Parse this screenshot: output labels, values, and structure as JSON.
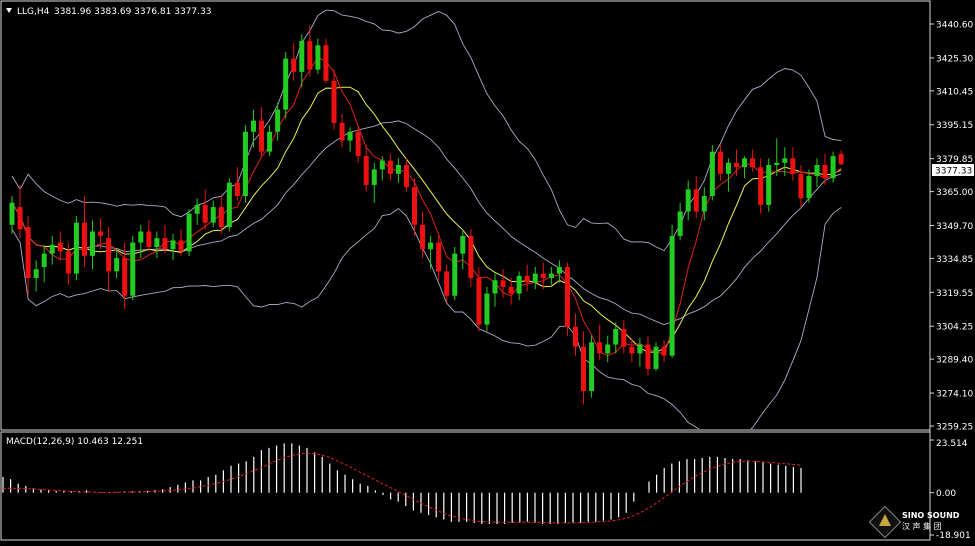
{
  "header": {
    "symbol_label": "LLG,H4",
    "ohlc_label": "3381.96 3383.69 3376.81 3377.33",
    "menu_icon": "triangle-down-icon"
  },
  "indicator": {
    "label": "MACD(12,26,9) 10.463 12.251"
  },
  "price_tag": "3377.33",
  "watermark": {
    "brand": "SINO SOUND",
    "chinese": "汉 声 集 团"
  },
  "colors": {
    "background": "#000000",
    "bull": "#22cc22",
    "bear": "#ee1111",
    "ma_fast": "#dd2222",
    "ma_slow": "#eeee55",
    "bands": "#a8acc8",
    "axis_text": "#ffffff",
    "macd_hist": "#ffffff",
    "macd_signal": "#dd2222"
  },
  "chart_data": [
    {
      "type": "candlestick",
      "title": "LLG,H4",
      "ylim": [
        3259.25,
        3452
      ],
      "y_ticks": [
        "3440.60",
        "3425.30",
        "3410.45",
        "3395.15",
        "3379.85",
        "3365.00",
        "3349.70",
        "3334.85",
        "3319.55",
        "3304.25",
        "3289.40",
        "3274.10",
        "3259.25"
      ],
      "series": [
        {
          "name": "price",
          "ohlc": [
            [
              3350,
              3363,
              3346,
              3360
            ],
            [
              3358,
              3368,
              3344,
              3348
            ],
            [
              3349,
              3354,
              3318,
              3326
            ],
            [
              3326,
              3334,
              3320,
              3330
            ],
            [
              3331,
              3341,
              3324,
              3337
            ],
            [
              3337,
              3345,
              3332,
              3341
            ],
            [
              3342,
              3347,
              3334,
              3338
            ],
            [
              3338,
              3342,
              3323,
              3328
            ],
            [
              3328,
              3354,
              3325,
              3351
            ],
            [
              3351,
              3363,
              3331,
              3336
            ],
            [
              3336,
              3352,
              3330,
              3347
            ],
            [
              3347,
              3353,
              3339,
              3345
            ],
            [
              3344,
              3349,
              3320,
              3329
            ],
            [
              3329,
              3339,
              3326,
              3335
            ],
            [
              3335,
              3342,
              3312,
              3318
            ],
            [
              3318,
              3345,
              3316,
              3342
            ],
            [
              3342,
              3350,
              3335,
              3347
            ],
            [
              3347,
              3352,
              3338,
              3340
            ],
            [
              3340,
              3347,
              3335,
              3344
            ],
            [
              3344,
              3350,
              3337,
              3339
            ],
            [
              3339,
              3346,
              3334,
              3343
            ],
            [
              3343,
              3348,
              3336,
              3338
            ],
            [
              3338,
              3357,
              3336,
              3355
            ],
            [
              3355,
              3362,
              3350,
              3359
            ],
            [
              3359,
              3366,
              3348,
              3351
            ],
            [
              3351,
              3361,
              3349,
              3358
            ],
            [
              3358,
              3363,
              3346,
              3349
            ],
            [
              3349,
              3371,
              3347,
              3369
            ],
            [
              3369,
              3376,
              3361,
              3363
            ],
            [
              3363,
              3395,
              3360,
              3392
            ],
            [
              3392,
              3402,
              3385,
              3397
            ],
            [
              3397,
              3403,
              3380,
              3383
            ],
            [
              3383,
              3395,
              3381,
              3392
            ],
            [
              3392,
              3405,
              3388,
              3402
            ],
            [
              3402,
              3428,
              3398,
              3425
            ],
            [
              3425,
              3432,
              3415,
              3419
            ],
            [
              3419,
              3436,
              3412,
              3433
            ],
            [
              3433,
              3440,
              3417,
              3420
            ],
            [
              3420,
              3434,
              3418,
              3431
            ],
            [
              3431,
              3434,
              3414,
              3415
            ],
            [
              3415,
              3420,
              3393,
              3396
            ],
            [
              3396,
              3400,
              3385,
              3388
            ],
            [
              3388,
              3394,
              3383,
              3392
            ],
            [
              3392,
              3395,
              3378,
              3381
            ],
            [
              3381,
              3386,
              3365,
              3368
            ],
            [
              3368,
              3378,
              3360,
              3375
            ],
            [
              3375,
              3381,
              3370,
              3379
            ],
            [
              3379,
              3382,
              3370,
              3373
            ],
            [
              3373,
              3380,
              3369,
              3377
            ],
            [
              3377,
              3380,
              3365,
              3367
            ],
            [
              3367,
              3371,
              3345,
              3350
            ],
            [
              3350,
              3356,
              3335,
              3339
            ],
            [
              3339,
              3345,
              3330,
              3342
            ],
            [
              3342,
              3346,
              3325,
              3329
            ],
            [
              3329,
              3332,
              3315,
              3318
            ],
            [
              3318,
              3340,
              3316,
              3337
            ],
            [
              3337,
              3348,
              3330,
              3345
            ],
            [
              3345,
              3348,
              3322,
              3326
            ],
            [
              3326,
              3331,
              3302,
              3305
            ],
            [
              3305,
              3322,
              3302,
              3319
            ],
            [
              3319,
              3328,
              3313,
              3325
            ],
            [
              3325,
              3330,
              3317,
              3322
            ],
            [
              3322,
              3326,
              3314,
              3319
            ],
            [
              3319,
              3329,
              3316,
              3327
            ],
            [
              3327,
              3332,
              3320,
              3324
            ],
            [
              3324,
              3331,
              3321,
              3328
            ],
            [
              3328,
              3333,
              3321,
              3326
            ],
            [
              3326,
              3331,
              3323,
              3328
            ],
            [
              3328,
              3334,
              3324,
              3331
            ],
            [
              3331,
              3333,
              3300,
              3304
            ],
            [
              3304,
              3310,
              3291,
              3295
            ],
            [
              3295,
              3302,
              3269,
              3275
            ],
            [
              3275,
              3300,
              3272,
              3297
            ],
            [
              3297,
              3305,
              3289,
              3292
            ],
            [
              3292,
              3300,
              3288,
              3296
            ],
            [
              3296,
              3306,
              3292,
              3303
            ],
            [
              3303,
              3307,
              3292,
              3295
            ],
            [
              3295,
              3299,
              3288,
              3292
            ],
            [
              3292,
              3299,
              3286,
              3296
            ],
            [
              3296,
              3300,
              3282,
              3285
            ],
            [
              3285,
              3297,
              3284,
              3295
            ],
            [
              3295,
              3298,
              3288,
              3291
            ],
            [
              3291,
              3350,
              3290,
              3345
            ],
            [
              3345,
              3360,
              3343,
              3356
            ],
            [
              3356,
              3370,
              3352,
              3366
            ],
            [
              3366,
              3372,
              3353,
              3356
            ],
            [
              3356,
              3367,
              3352,
              3363
            ],
            [
              3363,
              3386,
              3361,
              3383
            ],
            [
              3383,
              3386,
              3370,
              3373
            ],
            [
              3373,
              3380,
              3365,
              3378
            ],
            [
              3378,
              3384,
              3372,
              3376
            ],
            [
              3376,
              3381,
              3371,
              3380
            ],
            [
              3380,
              3384,
              3374,
              3376
            ],
            [
              3376,
              3380,
              3355,
              3359
            ],
            [
              3359,
              3380,
              3356,
              3377
            ],
            [
              3377,
              3389,
              3372,
              3378
            ],
            [
              3378,
              3385,
              3372,
              3380
            ],
            [
              3380,
              3385,
              3370,
              3373
            ],
            [
              3373,
              3377,
              3358,
              3362
            ],
            [
              3362,
              3375,
              3360,
              3372
            ],
            [
              3372,
              3380,
              3367,
              3377
            ],
            [
              3377,
              3382,
              3368,
              3371
            ],
            [
              3371,
              3383,
              3369,
              3381
            ],
            [
              3381.96,
              3383.69,
              3376.81,
              3377.33
            ]
          ]
        }
      ]
    },
    {
      "type": "bar",
      "title": "MACD(12,26,9) 10.463 12.251",
      "ylim": [
        -18.901,
        23.514
      ],
      "y_ticks": [
        "23.514",
        "0.00",
        "-18.901"
      ],
      "series": [
        {
          "name": "histogram",
          "values": [
            7,
            6,
            4,
            3,
            2,
            1.5,
            1.2,
            0.8,
            1,
            0.6,
            0.8,
            1,
            0.2,
            0.2,
            -0.2,
            0.2,
            0.6,
            0.6,
            0.8,
            0.8,
            1.2,
            1.5,
            2.5,
            3.5,
            4.5,
            5.5,
            5.5,
            7,
            8,
            10,
            12,
            13,
            14,
            16,
            19,
            20,
            21,
            22,
            22,
            21,
            20,
            18,
            16,
            13,
            10,
            8,
            6,
            4,
            3,
            1,
            -1,
            -3,
            -4,
            -6,
            -8,
            -9,
            -10,
            -11,
            -12,
            -13,
            -13,
            -13,
            -13.5,
            -14,
            -14,
            -14,
            -14,
            -13.5,
            -13.5,
            -13,
            -13.5,
            -14,
            -14,
            -14,
            -13.5,
            -13.5,
            -13.5,
            -13,
            -13,
            -12.5,
            -12,
            -11,
            -9,
            -4,
            0,
            5,
            8,
            11,
            13,
            14,
            15,
            15,
            15.5,
            16,
            16,
            15.5,
            15,
            15,
            14.5,
            14,
            13.5,
            13,
            12.5,
            12,
            11.5,
            11
          ]
        },
        {
          "name": "signal",
          "values": [
            2,
            2,
            1.9,
            1.8,
            1.6,
            1.4,
            1.2,
            1,
            0.8,
            0.6,
            0.4,
            0.3,
            0.2,
            0.1,
            0.1,
            0.1,
            0.2,
            0.3,
            0.4,
            0.5,
            0.6,
            0.8,
            1,
            1.3,
            1.7,
            2.1,
            2.7,
            3.3,
            4.1,
            5,
            6,
            7.2,
            8.4,
            9.8,
            11.2,
            12.8,
            14.3,
            15.6,
            16.6,
            17.3,
            17.6,
            17.4,
            16.8,
            15.7,
            14.2,
            12.6,
            10.9,
            9.1,
            7.4,
            5.6,
            3.9,
            2.2,
            0.5,
            -1.2,
            -3,
            -4.7,
            -6.3,
            -7.8,
            -9.2,
            -10.4,
            -11.3,
            -12,
            -12.5,
            -12.9,
            -13.1,
            -13.2,
            -13.2,
            -13.2,
            -13.2,
            -13.2,
            -13.2,
            -13.3,
            -13.4,
            -13.5,
            -13.5,
            -13.5,
            -13.4,
            -13.3,
            -13.1,
            -12.9,
            -12.6,
            -12.1,
            -11.4,
            -10.3,
            -8.7,
            -6.8,
            -4.6,
            -2.2,
            0.3,
            2.7,
            5,
            7.1,
            8.9,
            10.5,
            11.8,
            12.8,
            13.5,
            13.9,
            14.1,
            14,
            13.8,
            13.5,
            13.2,
            12.9,
            12.6,
            12.251
          ]
        }
      ]
    }
  ]
}
